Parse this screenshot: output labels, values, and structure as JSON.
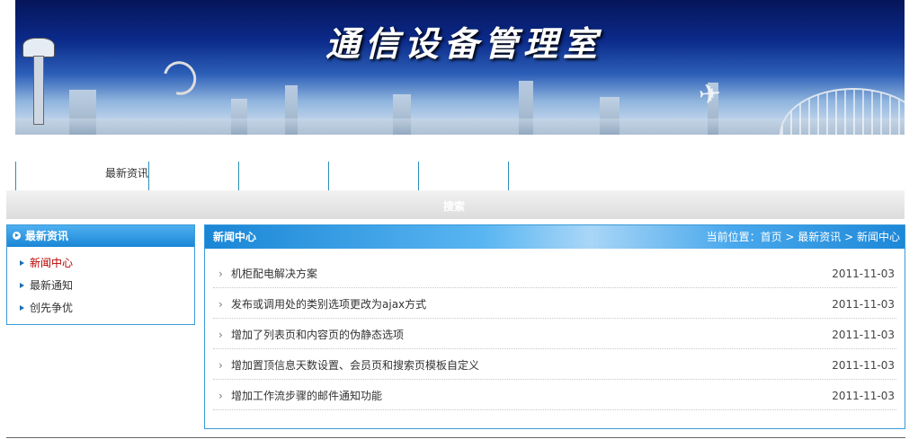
{
  "banner": {
    "title": "通信设备管理室"
  },
  "nav": {
    "items": [
      {
        "label": "最新资讯"
      },
      {
        "label": ""
      },
      {
        "label": ""
      },
      {
        "label": ""
      },
      {
        "label": ""
      }
    ]
  },
  "search": {
    "label": "搜索"
  },
  "sidebar": {
    "title": "最新资讯",
    "items": [
      {
        "label": "新闻中心",
        "active": true
      },
      {
        "label": "最新通知",
        "active": false
      },
      {
        "label": "创先争优",
        "active": false
      }
    ]
  },
  "main": {
    "title": "新闻中心",
    "breadcrumb": {
      "prefix": "当前位置：",
      "home": "首页",
      "sep1": " > ",
      "section": "最新资讯",
      "sep2": " > ",
      "current": "新闻中心"
    },
    "news": [
      {
        "title": "机柜配电解决方案",
        "date": "2011-11-03"
      },
      {
        "title": "发布或调用处的类别选项更改为ajax方式",
        "date": "2011-11-03"
      },
      {
        "title": "增加了列表页和内容页的伪静态选项",
        "date": "2011-11-03"
      },
      {
        "title": "增加置顶信息天数设置、会员页和搜索页模板自定义",
        "date": "2011-11-03"
      },
      {
        "title": "增加工作流步骤的邮件通知功能",
        "date": "2011-11-03"
      }
    ]
  },
  "colors": {
    "accent": "#1a86d6",
    "active_link": "#bb0000",
    "nav_divider": "#2a8fb8"
  }
}
